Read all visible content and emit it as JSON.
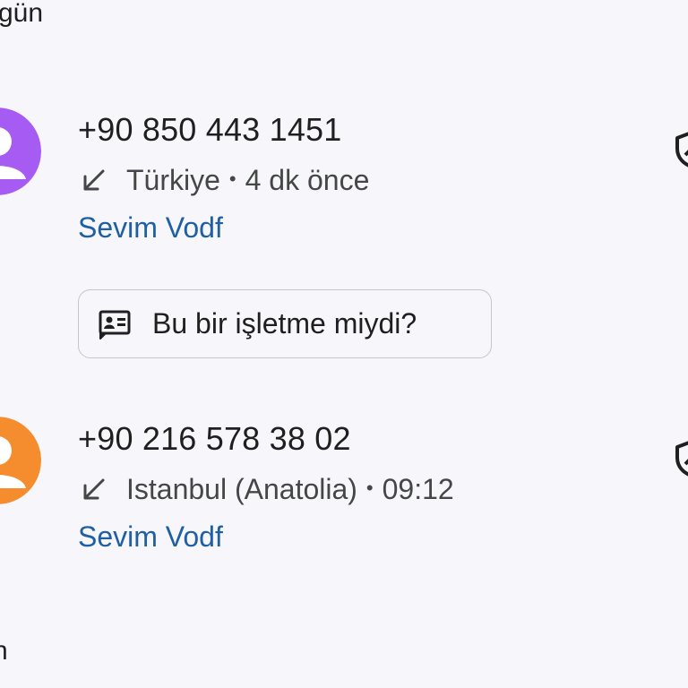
{
  "header": {
    "top_label": "gün",
    "bottom_label": "n"
  },
  "calls": [
    {
      "number": "+90 850 443 1451",
      "direction_icon": "incoming-call-arrow-icon",
      "location": "Türkiye",
      "time": "4 dk önce",
      "account": "Sevim Vodf",
      "avatar_color": "#a65cf2",
      "suggestion_chip": {
        "icon": "business-card-icon",
        "label": "Bu bir işletme miydi?"
      }
    },
    {
      "number": "+90 216 578 38 02",
      "direction_icon": "incoming-call-arrow-icon",
      "location": "Istanbul (Anatolia)",
      "time": "09:12",
      "account": "Sevim Vodf",
      "avatar_color": "#f58c2e"
    }
  ],
  "separator": "•",
  "colors": {
    "background": "#f7f6fb",
    "account_link": "#1f5fa3",
    "secondary_text": "#444746"
  }
}
